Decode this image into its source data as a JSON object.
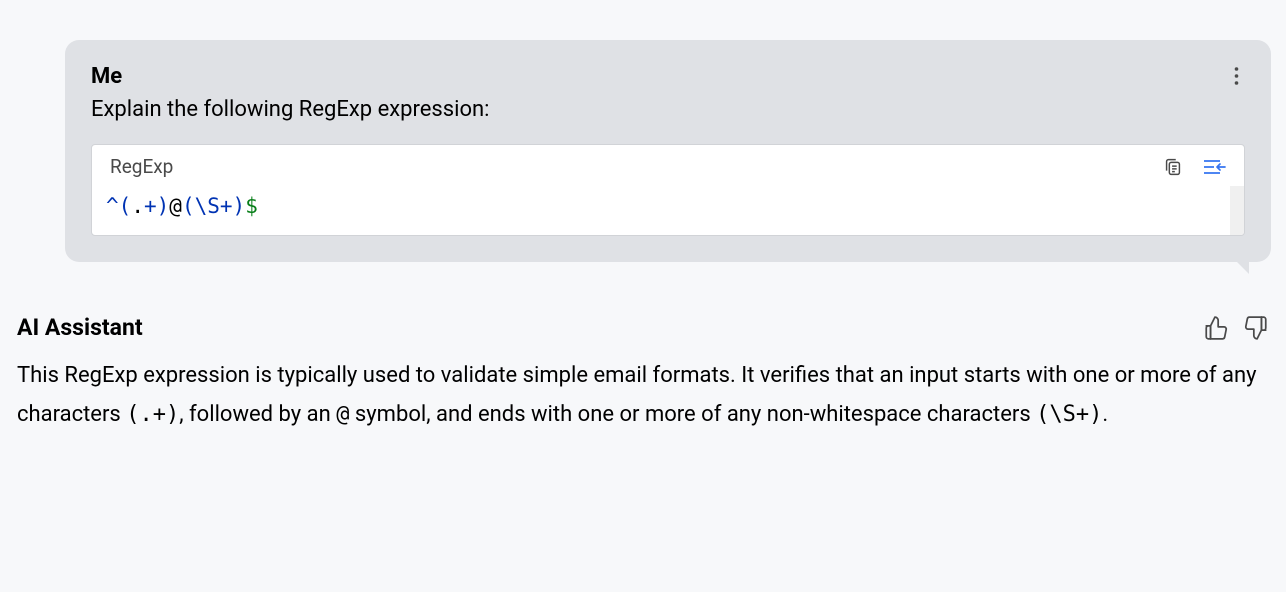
{
  "user": {
    "name": "Me",
    "prompt": "Explain the following RegExp expression:"
  },
  "code": {
    "language": "RegExp",
    "tokens": {
      "caret": "^",
      "lparen1": "(",
      "dot": ".",
      "plus1": "+",
      "rparen1": ")",
      "at": "@",
      "lparen2": "(",
      "escape_s": "\\S",
      "plus2": "+",
      "rparen2": ")",
      "dollar": "$"
    }
  },
  "assistant": {
    "name": "AI Assistant",
    "response_parts": {
      "p1": "This RegExp expression is typically used to validate simple email formats. It verifies that an input starts with one or more of any characters ",
      "c1": "(.+)",
      "p2": ", followed by an ",
      "c2": "@",
      "p3": " symbol, and ends with one or more of any non-whitespace characters ",
      "c3": "(\\S+)",
      "p4": "."
    }
  }
}
